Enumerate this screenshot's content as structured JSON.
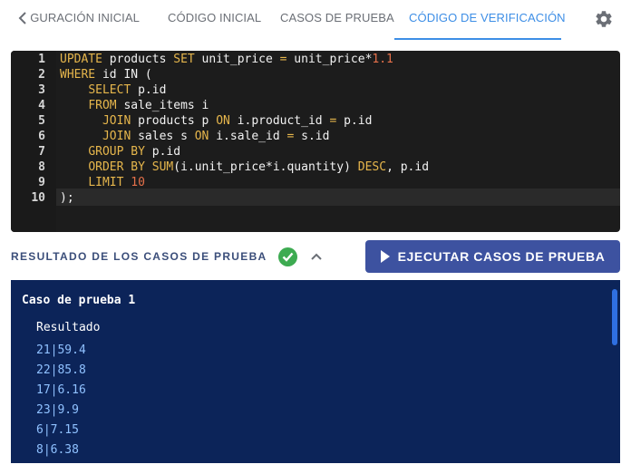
{
  "tabs": {
    "items": [
      {
        "label": "CONFIGURACIÓN INICIAL"
      },
      {
        "label": "CÓDIGO INICIAL"
      },
      {
        "label": "CASOS DE PRUEBA"
      },
      {
        "label": "CÓDIGO DE VERIFICACIÓN"
      }
    ],
    "active": "CÓDIGO DE VERIFICACIÓN"
  },
  "editor": {
    "line_numbers": [
      "1",
      "2",
      "3",
      "4",
      "5",
      "6",
      "7",
      "8",
      "9",
      "10"
    ],
    "lines": [
      [
        {
          "t": "UPDATE",
          "c": "kw"
        },
        {
          "t": " products ",
          "c": "plain"
        },
        {
          "t": "SET",
          "c": "kw"
        },
        {
          "t": " unit_price ",
          "c": "plain"
        },
        {
          "t": "=",
          "c": "kw"
        },
        {
          "t": " unit_price*",
          "c": "plain"
        },
        {
          "t": "1.1",
          "c": "num"
        }
      ],
      [
        {
          "t": "WHERE",
          "c": "kw"
        },
        {
          "t": " id IN (",
          "c": "plain"
        }
      ],
      [
        {
          "t": "    ",
          "c": "plain"
        },
        {
          "t": "SELECT",
          "c": "kw"
        },
        {
          "t": " p.id",
          "c": "plain"
        }
      ],
      [
        {
          "t": "    ",
          "c": "plain"
        },
        {
          "t": "FROM",
          "c": "kw"
        },
        {
          "t": " sale_items i",
          "c": "plain"
        }
      ],
      [
        {
          "t": "      ",
          "c": "plain"
        },
        {
          "t": "JOIN",
          "c": "kw"
        },
        {
          "t": " products p ",
          "c": "plain"
        },
        {
          "t": "ON",
          "c": "kw"
        },
        {
          "t": " i.product_id ",
          "c": "plain"
        },
        {
          "t": "=",
          "c": "kw"
        },
        {
          "t": " p.id",
          "c": "plain"
        }
      ],
      [
        {
          "t": "      ",
          "c": "plain"
        },
        {
          "t": "JOIN",
          "c": "kw"
        },
        {
          "t": " sales s ",
          "c": "plain"
        },
        {
          "t": "ON",
          "c": "kw"
        },
        {
          "t": " i.sale_id ",
          "c": "plain"
        },
        {
          "t": "=",
          "c": "kw"
        },
        {
          "t": " s.id",
          "c": "plain"
        }
      ],
      [
        {
          "t": "    ",
          "c": "plain"
        },
        {
          "t": "GROUP BY",
          "c": "kw"
        },
        {
          "t": " p.id",
          "c": "plain"
        }
      ],
      [
        {
          "t": "    ",
          "c": "plain"
        },
        {
          "t": "ORDER BY",
          "c": "kw"
        },
        {
          "t": " ",
          "c": "plain"
        },
        {
          "t": "SUM",
          "c": "kw"
        },
        {
          "t": "(i.unit_price*i.quantity) ",
          "c": "plain"
        },
        {
          "t": "DESC",
          "c": "kw"
        },
        {
          "t": ", p.id",
          "c": "plain"
        }
      ],
      [
        {
          "t": "    ",
          "c": "plain"
        },
        {
          "t": "LIMIT",
          "c": "kw"
        },
        {
          "t": " ",
          "c": "plain"
        },
        {
          "t": "10",
          "c": "num"
        }
      ],
      [
        {
          "t": ");",
          "c": "plain"
        }
      ]
    ]
  },
  "results": {
    "title": "RESULTADO DE LOS CASOS DE PRUEBA",
    "status_icon": "check-circle",
    "run_button_label": "EJECUTAR CASOS DE PRUEBA",
    "test_case_title": "Caso de prueba 1",
    "result_label": "Resultado",
    "rows": [
      "21|59.4",
      "22|85.8",
      "17|6.16",
      "23|9.9",
      "6|7.15",
      "8|6.38"
    ]
  },
  "colors": {
    "accent": "#3d8ee6",
    "run_button": "#3d52a0",
    "success": "#3dab51",
    "output_bg": "#0c2459",
    "result_text": "#8fc1ff",
    "keyword": "#e6b64c",
    "number": "#e5704a"
  }
}
